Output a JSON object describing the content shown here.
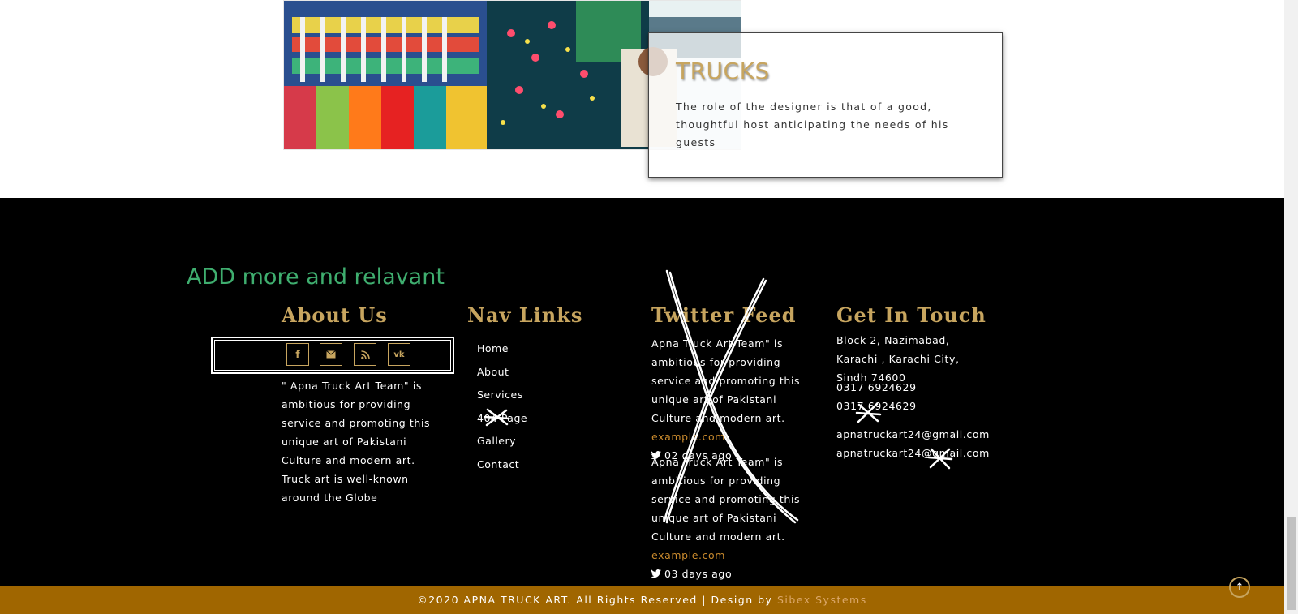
{
  "card": {
    "title": "TRUCKS",
    "text": "The role of the designer is that of a good, thoughtful host anticipating the needs of his guests"
  },
  "footer": {
    "annotation": "ADD more and relavant",
    "about": {
      "title": "About Us",
      "text": "\" Apna Truck Art Team\" is ambitious for providing service and promoting this unique art of Pakistani Culture and modern art. Truck art is well-known around the Globe",
      "social": [
        "facebook-icon",
        "envelope-icon",
        "rss-icon",
        "vk-icon"
      ]
    },
    "nav": {
      "title": "Nav Links",
      "items": [
        "Home",
        "About",
        "Services",
        "404 Page",
        "Gallery",
        "Contact"
      ]
    },
    "twitter": {
      "title": "Twitter Feed",
      "tweets": [
        {
          "text": "Apna Truck Art Team\" is ambitious for providing service and promoting this unique art of Pakistani Culture and modern art.",
          "link": "example.com",
          "time": "02 days ago"
        },
        {
          "text": "Apna Truck Art Team\" is ambitious for providing service and promoting this unique art of Pakistani Culture and modern art.",
          "link": "example.com",
          "time": "03 days ago"
        }
      ]
    },
    "contact": {
      "title": "Get In Touch",
      "address": "Block 2, Nazimabad, Karachi , Karachi City, Sindh 74600",
      "phones": [
        "0317 6924629",
        "0317 6924629"
      ],
      "emails": [
        "apnatruckart24@gmail.com",
        "apnatruckart24@gmail.com"
      ]
    }
  },
  "bottom": {
    "copyright": "©2020 APNA TRUCK ART. All Rights Reserved | Design by ",
    "credit": "Sibex Systems"
  },
  "colors": {
    "accent": "#c7a55f",
    "bottom_bar": "#a06600",
    "annotation": "#3fae6f",
    "link": "#c98a2d"
  }
}
